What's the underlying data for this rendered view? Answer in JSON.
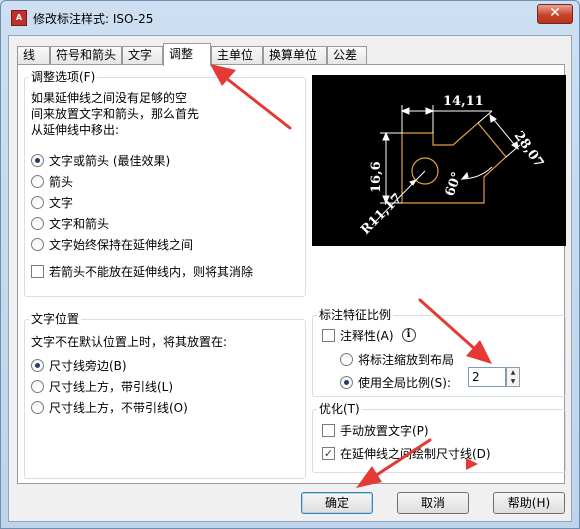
{
  "window": {
    "title": "修改标注样式: ISO-25",
    "app_icon": "autocad-app-icon",
    "close_symbol": "✕"
  },
  "tabs": [
    {
      "label": "线"
    },
    {
      "label": "符号和箭头"
    },
    {
      "label": "文字"
    },
    {
      "label": "调整",
      "active": true
    },
    {
      "label": "主单位"
    },
    {
      "label": "换算单位"
    },
    {
      "label": "公差"
    }
  ],
  "fit_options": {
    "title": "调整选项(F)",
    "description": [
      "如果延伸线之间没有足够的空",
      "间来放置文字和箭头，那么首先",
      "从延伸线中移出:"
    ],
    "radios": [
      {
        "label": "文字或箭头 (最佳效果)",
        "checked": true
      },
      {
        "label": "箭头",
        "checked": false
      },
      {
        "label": "文字",
        "checked": false
      },
      {
        "label": "文字和箭头",
        "checked": false
      },
      {
        "label": "文字始终保持在延伸线之间",
        "checked": false
      }
    ],
    "suppress_arrows": {
      "label": "若箭头不能放在延伸线内，则将其消除",
      "checked": false
    }
  },
  "preview": {
    "labels": {
      "top": "14,11",
      "left": "16,6",
      "right": "28,07",
      "angle": "60°",
      "radius": "R11,17"
    },
    "colors": {
      "background": "#000000",
      "geometry": "#e0a040",
      "dimension": "#ffffff"
    }
  },
  "text_placement": {
    "title": "文字位置",
    "description": "文字不在默认位置上时，将其放置在:",
    "radios": [
      {
        "label": "尺寸线旁边(B)",
        "checked": true
      },
      {
        "label": "尺寸线上方，带引线(L)",
        "checked": false
      },
      {
        "label": "尺寸线上方，不带引线(O)",
        "checked": false
      }
    ]
  },
  "scale": {
    "title": "标注特征比例",
    "annotative": {
      "label": "注释性(A)",
      "checked": false
    },
    "info_symbol": "i",
    "radios": [
      {
        "label": "将标注缩放到布局",
        "checked": false
      },
      {
        "label": "使用全局比例(S):",
        "checked": true
      }
    ],
    "global_scale_value": "2"
  },
  "finetune": {
    "title": "优化(T)",
    "manual_place": {
      "label": "手动放置文字(P)",
      "checked": false
    },
    "draw_dim_line": {
      "label": "在延伸线之间绘制尺寸线(D)",
      "checked": true
    }
  },
  "buttons": {
    "ok": "确定",
    "cancel": "取消",
    "help": "帮助(H)"
  },
  "annotation_color": "#e53935"
}
